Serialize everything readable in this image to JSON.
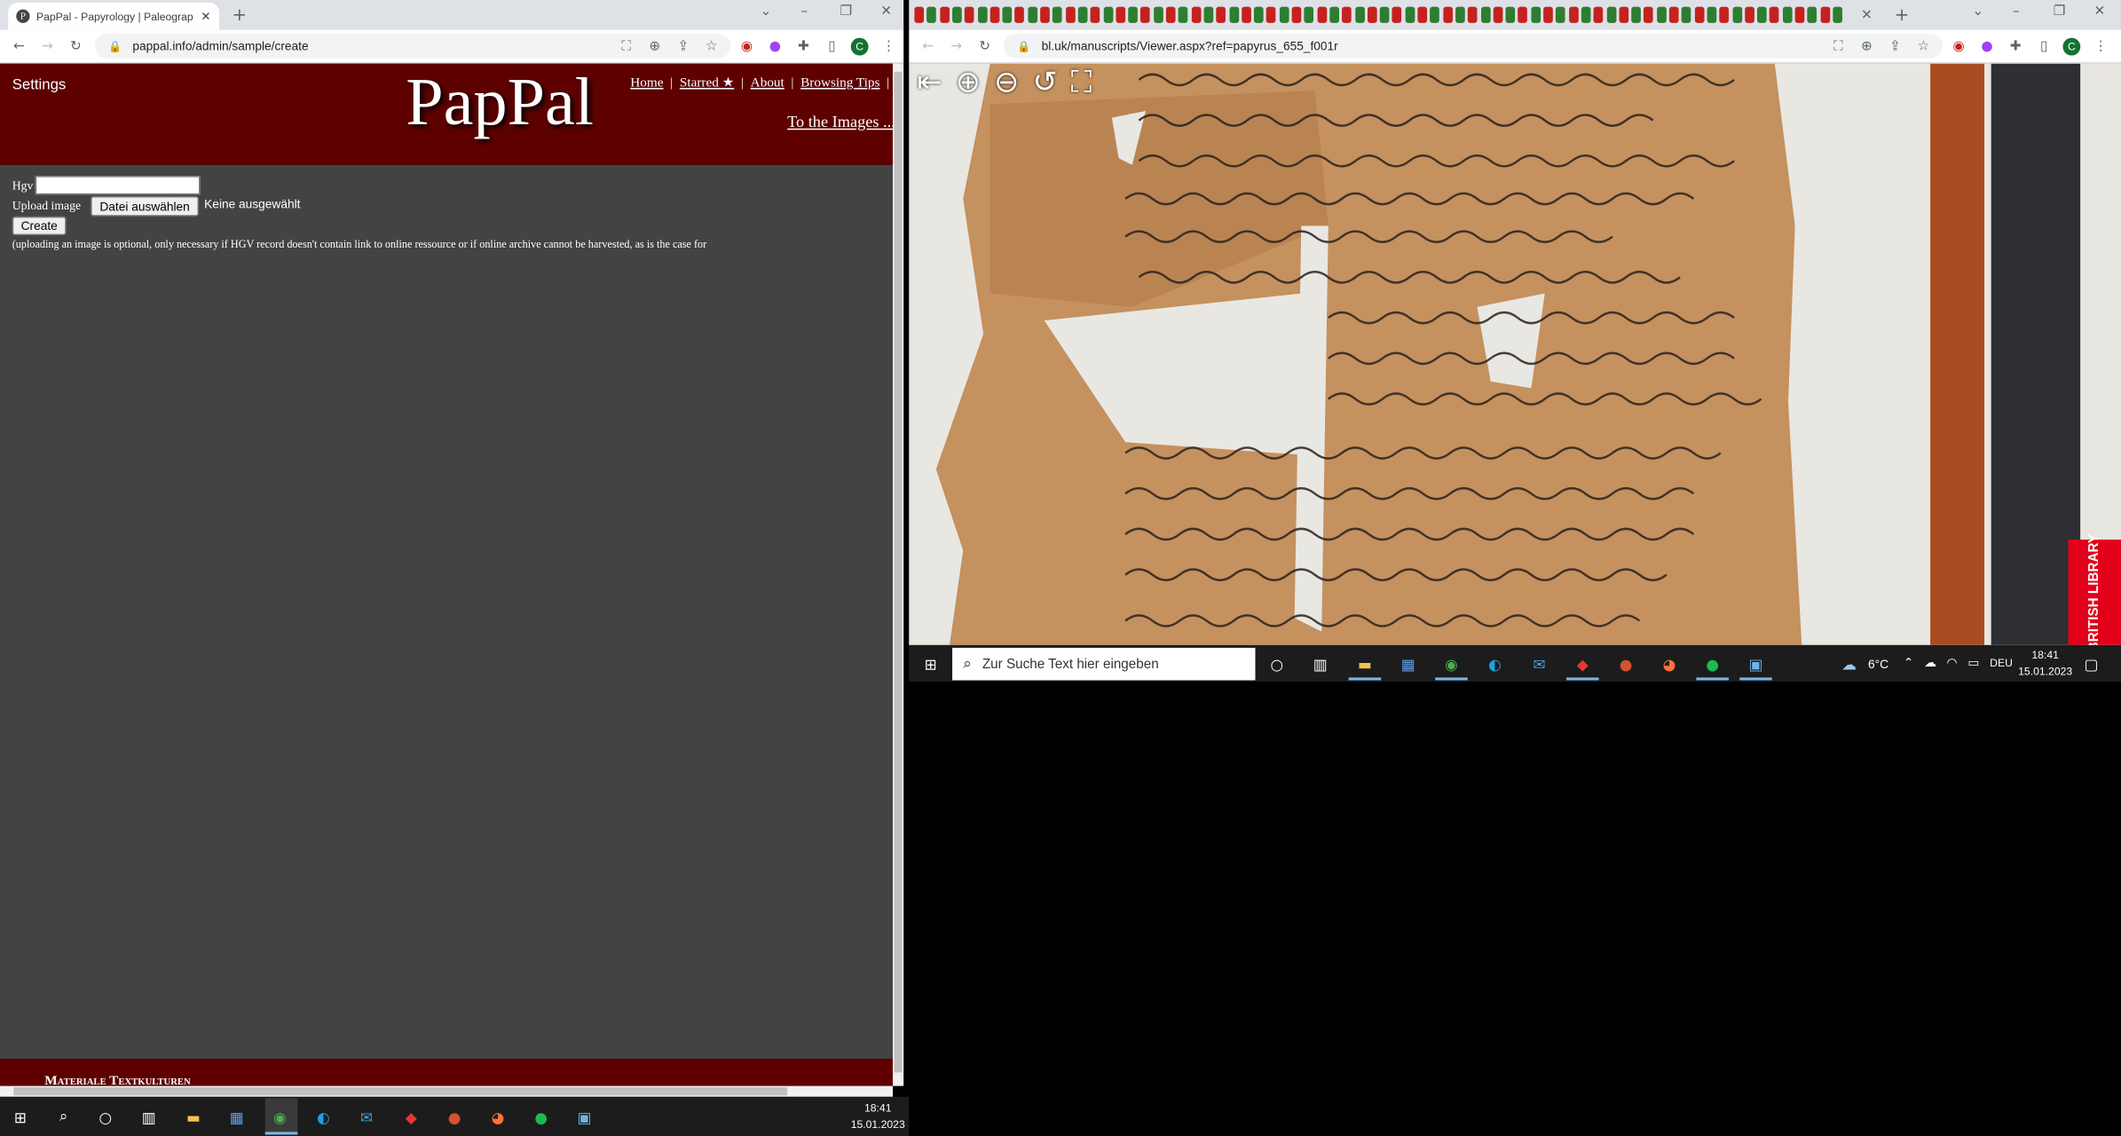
{
  "left_browser": {
    "tab_title": "PapPal - Papyrology | Paleograph",
    "url": "pappal.info/admin/sample/create",
    "profile_initial": "C"
  },
  "pappal": {
    "settings_label": "Settings",
    "logo": "PapPal",
    "nav": [
      "Home",
      "Starred ★",
      "About",
      "Browsing Tips"
    ],
    "nav_sep": "|",
    "to_images": "To the Images ...",
    "hgv_label": "Hgv",
    "hgv_value": "",
    "upload_label": "Upload image",
    "file_button": "Datei auswählen",
    "file_status": "Keine ausgewählt",
    "create_button": "Create",
    "note": "(uploading an image is optional, only necessary if HGV record doesn't contain link to online ressource or if online archive cannot be harvested, as is the case for",
    "footer_text": "Materiale Textkulturen"
  },
  "right_browser": {
    "url": "bl.uk/manuscripts/Viewer.aspx?ref=papyrus_655_f001r",
    "profile_initial": "C",
    "bl_badge": "BRITISH LIBRARY"
  },
  "viewer_tools": [
    "back-icon",
    "zoom-in-icon",
    "zoom-out-icon",
    "rotate-icon",
    "fullscreen-icon"
  ],
  "inner_taskbar": {
    "search_placeholder": "Zur Suche Text hier eingeben",
    "temperature": "6°C",
    "language": "DEU",
    "time": "18:41",
    "date": "15.01.2023"
  },
  "taskbar": {
    "time": "18:41",
    "date": "15.01.2023"
  },
  "colors": {
    "pappal_red": "#5e0000",
    "pappal_body": "#434343",
    "papyrus": "#c4915f",
    "bl_red": "#e2001a"
  }
}
